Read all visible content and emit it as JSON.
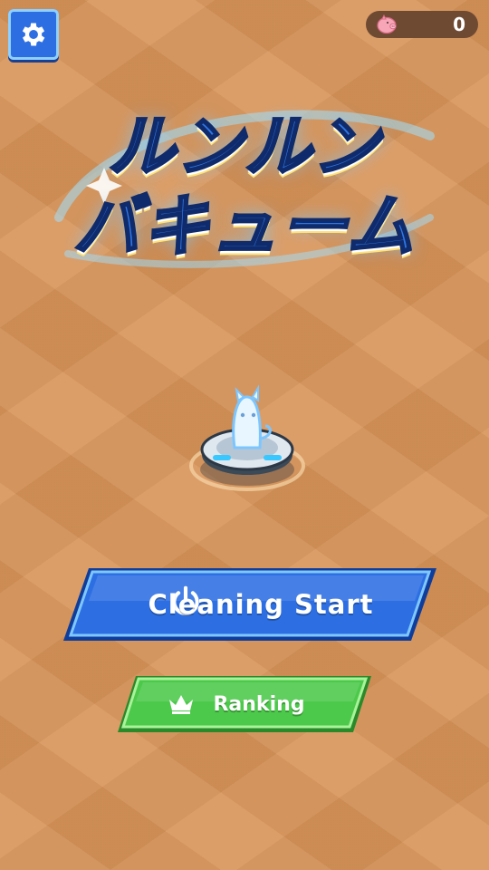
{
  "header": {
    "settings_icon": "gear-icon",
    "coin_icon": "piggy-bank-icon",
    "coin_count": "0"
  },
  "logo": {
    "line1": "ルンルン",
    "line2": "バキューム"
  },
  "menu": {
    "start_label": "Cleaning Start",
    "start_icon": "power-icon",
    "ranking_label": "Ranking",
    "ranking_icon": "crown-icon"
  },
  "colors": {
    "background": "#d9955a",
    "start_button": "#2d6fe3",
    "ranking_button": "#4cc94a",
    "coin_pill": "#6f4a33"
  }
}
